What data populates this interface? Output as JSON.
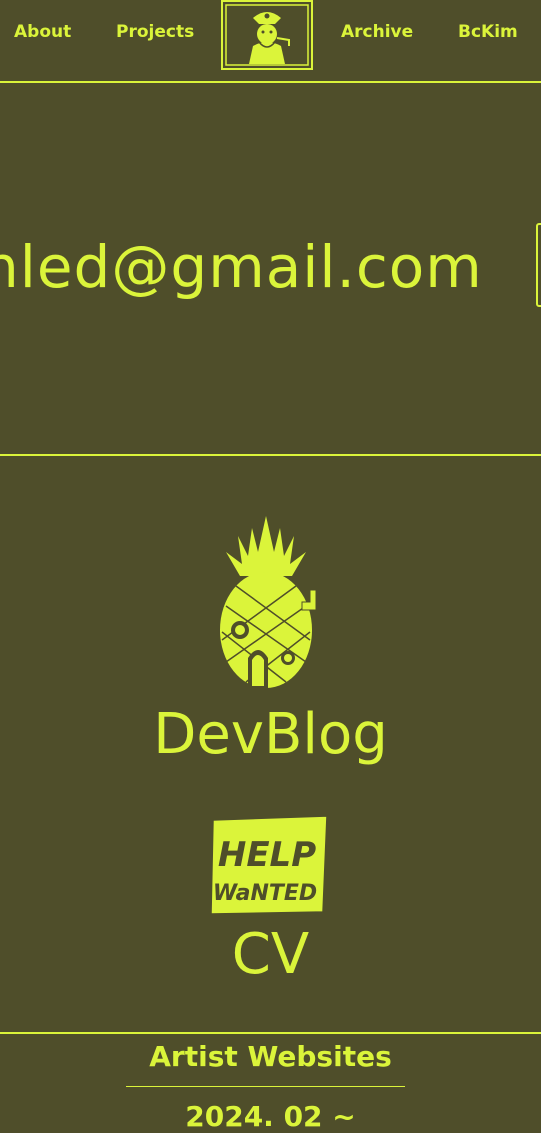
{
  "nav": {
    "items": [
      "About",
      "Projects",
      "Archive",
      "BcKim"
    ]
  },
  "hero": {
    "email_text": "nled@gmail.com"
  },
  "links": {
    "devblog": "DevBlog",
    "cv": "CV",
    "help_sign": [
      "HELP",
      "WaNTED"
    ]
  },
  "footer": {
    "title": "Artist Websites",
    "date": "2024. 02 ~"
  },
  "colors": {
    "background": "#4f4e2a",
    "accent": "#dbf43a"
  }
}
